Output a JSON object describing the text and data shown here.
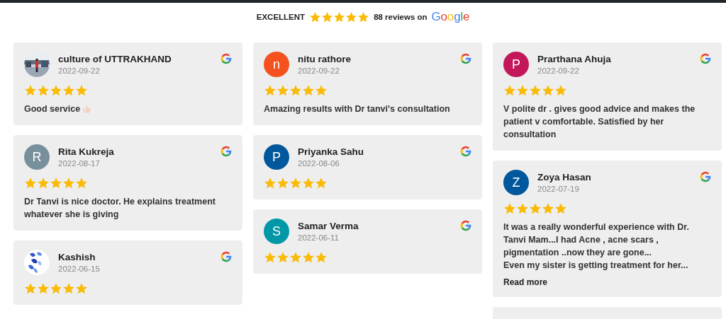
{
  "summary": {
    "rating_label": "EXCELLENT",
    "stars": 5,
    "count_text": "88 reviews on",
    "brand": "Google"
  },
  "columns": [
    {
      "reviews": [
        {
          "name": "culture of UTTRAKHAND",
          "date": "2022-09-22",
          "stars": 5,
          "text": "Good service",
          "thumbs_up": true
        },
        {
          "name": "Rita Kukreja",
          "date": "2022-08-17",
          "stars": 5,
          "avatar": {
            "kind": "letter",
            "letter": "R",
            "color": "#78909c"
          },
          "text": "Dr Tanvi is nice doctor. He explains treatment whatever she is giving"
        },
        {
          "name": "Kashish",
          "date": "2022-06-15",
          "stars": 5
        }
      ]
    },
    {
      "reviews": [
        {
          "name": "nitu rathore",
          "date": "2022-09-22",
          "stars": 5,
          "avatar": {
            "kind": "letter",
            "letter": "n",
            "color": "#f4511e"
          },
          "text": "Amazing results with Dr tanvi's consultation"
        },
        {
          "name": "Priyanka Sahu",
          "date": "2022-08-06",
          "stars": 5,
          "avatar": {
            "kind": "letter",
            "letter": "P",
            "color": "#01579b"
          }
        },
        {
          "name": "Samar Verma",
          "date": "2022-06-11",
          "stars": 5,
          "avatar": {
            "kind": "letter",
            "letter": "S",
            "color": "#0097a7"
          }
        }
      ]
    },
    {
      "reviews": [
        {
          "name": "Prarthana Ahuja",
          "date": "2022-09-22",
          "stars": 5,
          "avatar": {
            "kind": "letter",
            "letter": "P",
            "color": "#c2185b"
          },
          "text": "V polite dr . gives good advice and makes the patient v comfortable. Satisfied by her consultation"
        },
        {
          "name": "Zoya Hasan",
          "date": "2022-07-19",
          "stars": 5,
          "avatar": {
            "kind": "letter",
            "letter": "Z",
            "color": "#01579b"
          },
          "text": "It was a really wonderful experience with Dr. Tanvi Mam...I had Acne , acne scars , pigmentation ..now they are gone...\nEven my sister is getting treatment for her...",
          "link": "Read more"
        }
      ]
    }
  ]
}
